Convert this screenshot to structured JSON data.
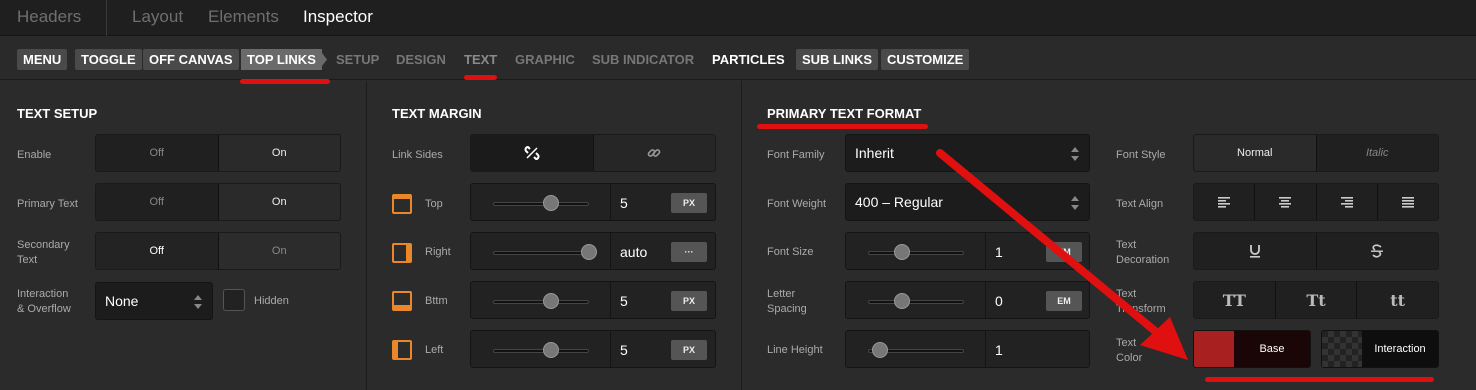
{
  "top_tabs": [
    {
      "label": "Headers",
      "active": false
    },
    {
      "label": "Layout",
      "active": false
    },
    {
      "label": "Elements",
      "active": false
    },
    {
      "label": "Inspector",
      "active": true
    }
  ],
  "sub_tabs": [
    {
      "label": "MENU"
    },
    {
      "label": "TOGGLE"
    },
    {
      "label": "OFF CANVAS"
    },
    {
      "label": "TOP LINKS"
    },
    {
      "label": "SETUP"
    },
    {
      "label": "DESIGN"
    },
    {
      "label": "TEXT"
    },
    {
      "label": "GRAPHIC"
    },
    {
      "label": "SUB INDICATOR"
    },
    {
      "label": "PARTICLES"
    },
    {
      "label": "SUB LINKS"
    },
    {
      "label": "CUSTOMIZE"
    }
  ],
  "text_setup": {
    "title": "TEXT SETUP",
    "enable_label": "Enable",
    "enable_off": "Off",
    "enable_on": "On",
    "primary_label": "Primary Text",
    "primary_off": "Off",
    "primary_on": "On",
    "secondary_label_1": "Secondary",
    "secondary_label_2": "Text",
    "secondary_off": "Off",
    "secondary_on": "On",
    "interaction_label_1": "Interaction",
    "interaction_label_2": "& Overflow",
    "interaction_value": "None",
    "hidden_label": "Hidden"
  },
  "text_margin": {
    "title": "TEXT MARGIN",
    "link_sides_label": "Link Sides",
    "top_label": "Top",
    "top_value": "5",
    "top_unit": "PX",
    "top_slider": 0.6,
    "right_label": "Right",
    "right_value": "auto",
    "right_unit": "···",
    "right_slider": 1.0,
    "bottom_label": "Bttm",
    "bottom_value": "5",
    "bottom_unit": "PX",
    "bottom_slider": 0.6,
    "left_label": "Left",
    "left_value": "5",
    "left_unit": "PX",
    "left_slider": 0.6
  },
  "primary_text_format": {
    "title": "PRIMARY TEXT FORMAT",
    "font_family_label": "Font Family",
    "font_family_value": "Inherit",
    "font_weight_label": "Font Weight",
    "font_weight_value": "400 – Regular",
    "font_size_label": "Font Size",
    "font_size_value": "1",
    "font_size_unit": "EM",
    "font_size_slider": 0.35,
    "letter_spacing_label_1": "Letter",
    "letter_spacing_label_2": "Spacing",
    "letter_spacing_value": "0",
    "letter_spacing_unit": "EM",
    "letter_spacing_slider": 0.35,
    "line_height_label": "Line Height",
    "line_height_value": "1",
    "line_height_slider": 0.12,
    "font_style_label": "Font Style",
    "font_style_normal": "Normal",
    "font_style_italic": "Italic",
    "text_align_label": "Text Align",
    "text_decoration_label_1": "Text",
    "text_decoration_label_2": "Decoration",
    "text_transform_label_1": "Text",
    "text_transform_label_2": "Transform",
    "transform_upper": "TT",
    "transform_capitalize": "Tt",
    "transform_lower": "tt",
    "text_color_label_1": "Text",
    "text_color_label_2": "Color",
    "color_base_label": "Base",
    "color_interaction_label": "Interaction",
    "base_color": "#a82020"
  },
  "colors": {
    "accent_orange": "#e8882a",
    "annotation_red": "#e01010"
  }
}
